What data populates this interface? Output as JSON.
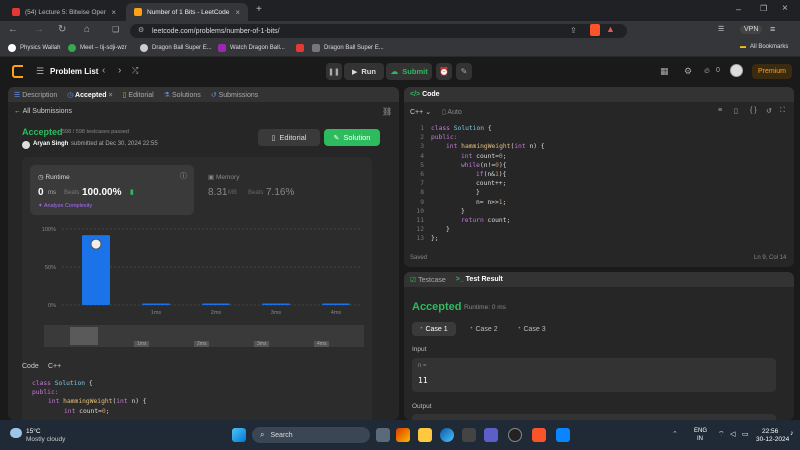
{
  "browser": {
    "tab1": "(54) Lecture 5: Bitwise Operators, F...",
    "tab2": "Number of 1 Bits - LeetCode",
    "plus": "+",
    "url": "leetcode.com/problems/number-of-1-bits/",
    "vpn": "VPN",
    "bookmarks": [
      "Physics Wallah",
      "Meet – tij-sdji-wzr",
      "Dragon Ball Super E...",
      "Watch Dragon Ball...",
      "Dragon Ball Super E..."
    ],
    "all_bookmarks": "All Bookmarks"
  },
  "lc": {
    "problem_list": "Problem List",
    "run": "Run",
    "submit": "Submit",
    "streak": "0",
    "premium": "Premium"
  },
  "left": {
    "tabs": [
      "Description",
      "Accepted",
      "Editorial",
      "Solutions",
      "Submissions"
    ],
    "all_submissions": "All Submissions",
    "status": "Accepted",
    "passed": "598 / 598 testcases passed",
    "user": "Aryan Singh",
    "submitted": "submitted at Dec 30, 2024 22:55",
    "editorial_btn": "Editorial",
    "solution_btn": "Solution",
    "runtime_label": "Runtime",
    "runtime_val": "0",
    "runtime_unit": "ms",
    "beats": "Beats",
    "beats_val": "100.00%",
    "analyze": "Analyze Complexity",
    "memory_label": "Memory",
    "memory_val": "8.31",
    "memory_unit": "MB",
    "memory_beats": "Beats",
    "memory_beats_val": "7.16%",
    "code_label": "Code",
    "lang": "C++"
  },
  "chart_data": {
    "type": "bar",
    "y_ticks": [
      "100%",
      "50%",
      "0%"
    ],
    "categories": [
      "0ms",
      "1ms",
      "2ms",
      "3ms",
      "4ms"
    ],
    "x_tick_labels": [
      "",
      "1ms",
      "2ms",
      "3ms",
      "4ms"
    ],
    "values": [
      92,
      2,
      2,
      2,
      2
    ],
    "ylim": [
      0,
      100
    ],
    "highlight_color": "#1a73e8",
    "bar_color": "#1a73e8",
    "scrubber_labels": [
      "1ms",
      "2ms",
      "3ms",
      "4ms"
    ]
  },
  "editor": {
    "title": "Code",
    "lang": "C++",
    "auto": "Auto",
    "saved": "Saved",
    "pos": "Ln 9, Col 14"
  },
  "right_bottom": {
    "tab1": "Testcase",
    "tab2": "Test Result",
    "status": "Accepted",
    "runtime": "Runtime: 0 ms",
    "cases": [
      "Case 1",
      "Case 2",
      "Case 3"
    ],
    "input_label": "Input",
    "var": "n =",
    "value": "11",
    "output_label": "Output"
  },
  "taskbar": {
    "temp": "15°C",
    "weather": "Mostly cloudy",
    "search": "Search",
    "lang": "ENG",
    "region": "IN",
    "time": "22:56",
    "date": "30-12-2024"
  }
}
